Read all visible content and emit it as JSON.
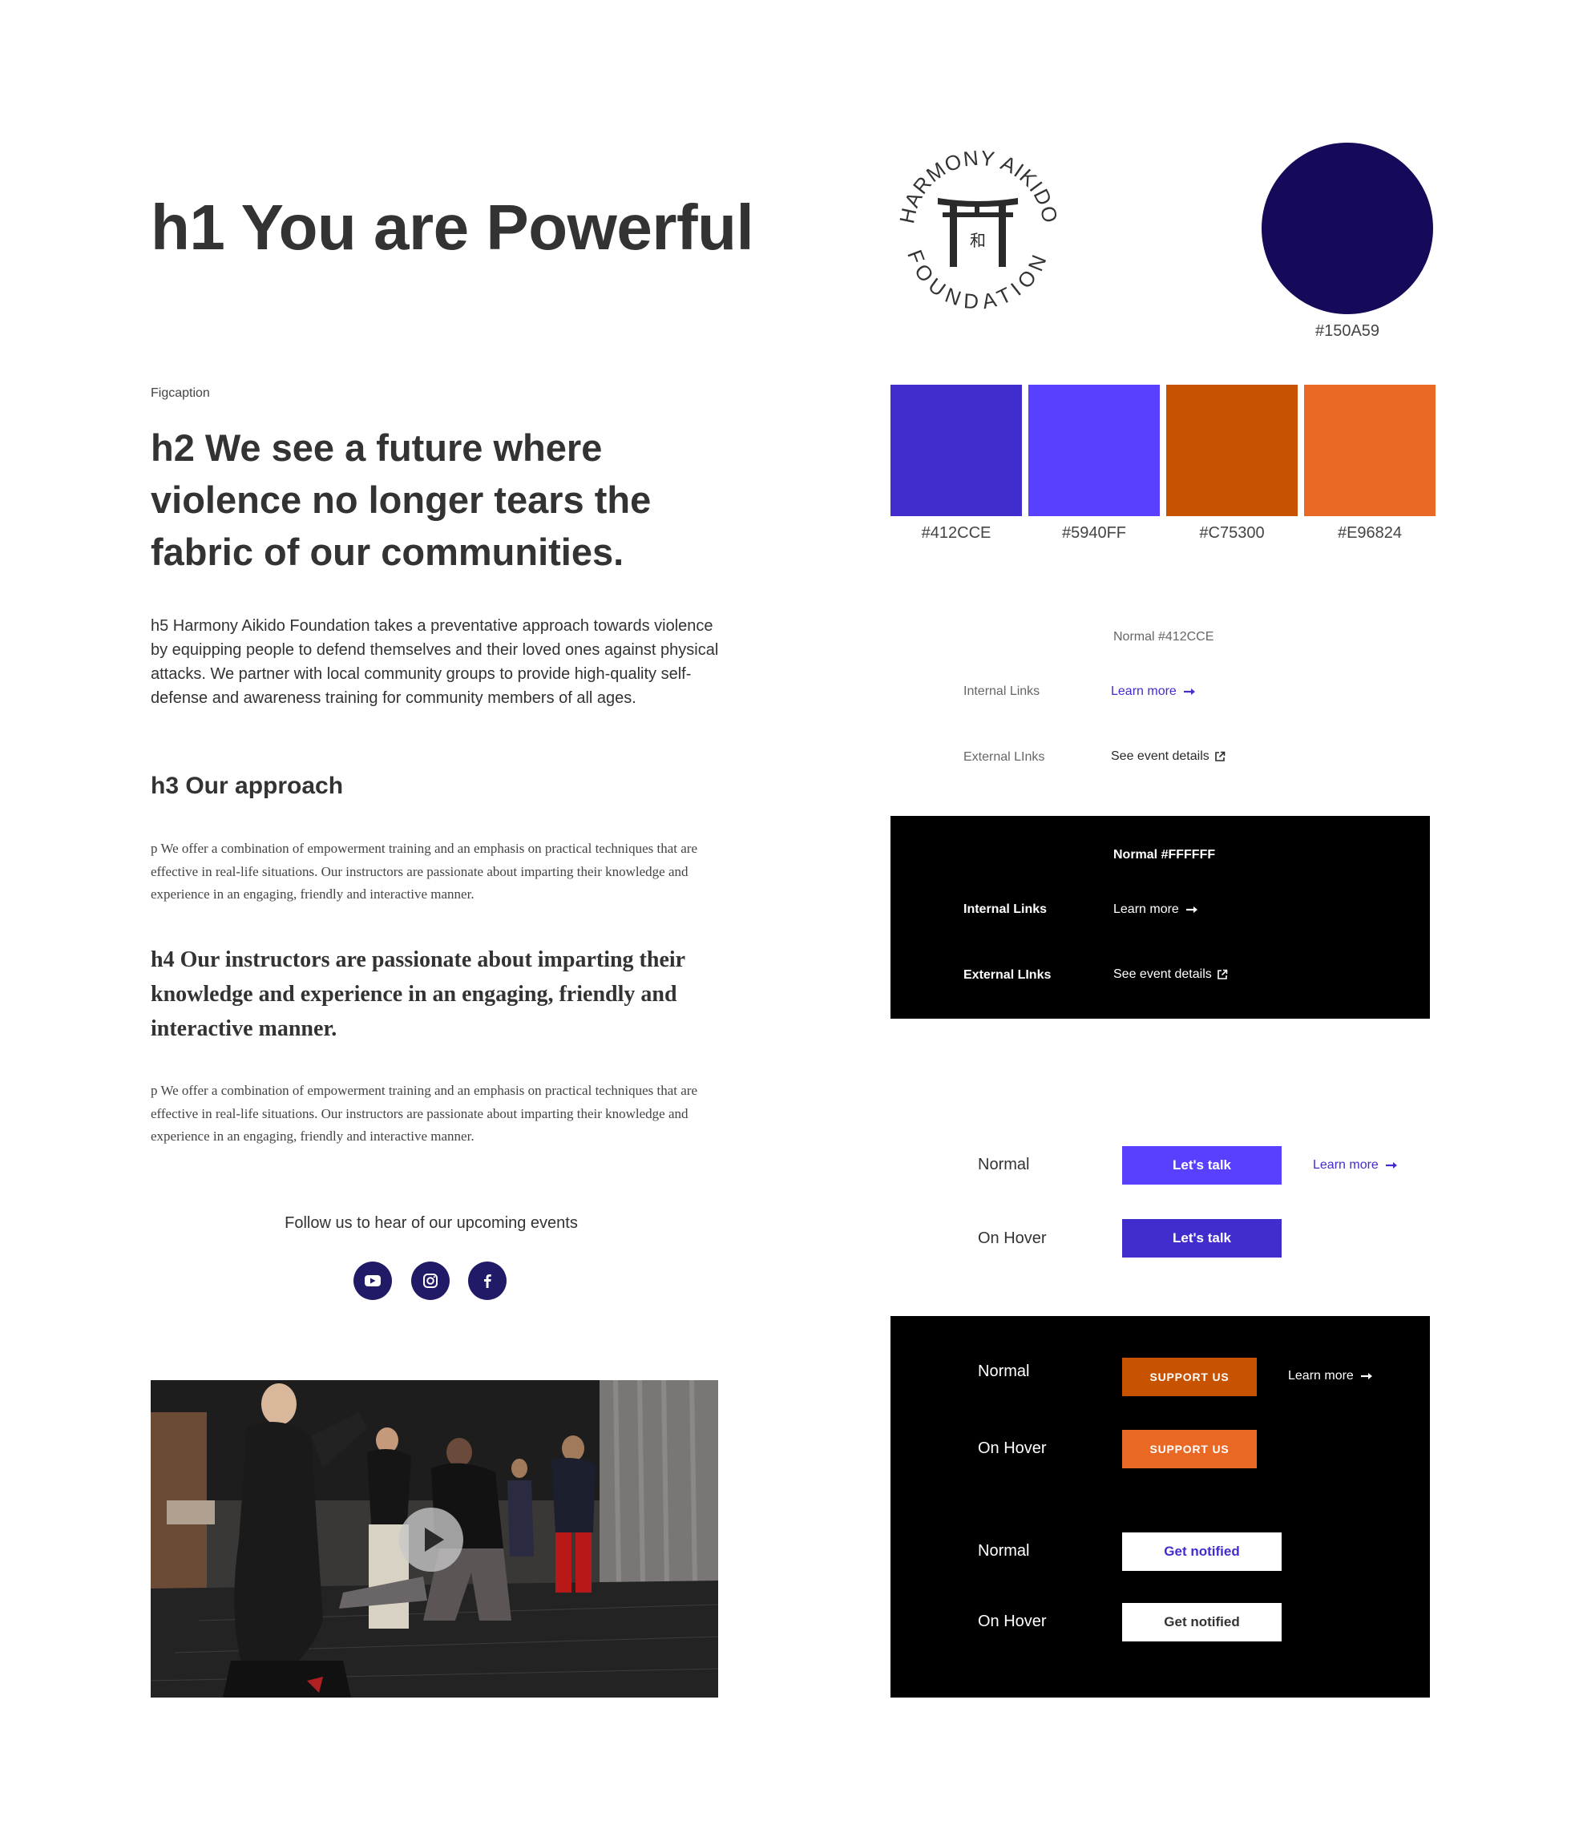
{
  "typography": {
    "h1": "h1 You are Powerful",
    "figcaption": "Figcaption",
    "h2": "h2 We see a future where violence no longer tears the fabric of our communities.",
    "h5": "h5 Harmony Aikido Foundation takes a preventative approach towards violence by equipping people to defend themselves and their loved ones against physical attacks. We partner with local community groups to provide high-quality self-defense and awareness training for community members of all ages.",
    "h3": "h3 Our approach",
    "p1": "p We offer a combination of empowerment training and an emphasis on practical techniques that are effective in real-life situations.  Our instructors are passionate about imparting their knowledge and experience in an engaging, friendly and interactive manner.",
    "h4": "h4 Our instructors are passionate about imparting their knowledge and experience in an engaging, friendly and interactive manner.",
    "p2": "p We offer a combination of empowerment training and an emphasis on practical techniques that are effective in real-life situations.  Our instructors are passionate about imparting their knowledge and experience in an engaging, friendly and interactive manner."
  },
  "social": {
    "text": "Follow us to hear of our upcoming events",
    "icons": [
      "youtube-icon",
      "instagram-icon",
      "facebook-icon"
    ],
    "bg_color": "#211A66"
  },
  "logo": {
    "top_text": "HARMONY AIKIDO",
    "bottom_text": "FOUNDATION"
  },
  "palette": {
    "primary": {
      "hex": "#150A59",
      "label": "#150A59"
    },
    "swatches": [
      {
        "hex": "#412CCE",
        "label": "#412CCE"
      },
      {
        "hex": "#5940FF",
        "label": "#5940FF"
      },
      {
        "hex": "#C75300",
        "label": "#C75300"
      },
      {
        "hex": "#E96824",
        "label": "#E96824"
      }
    ]
  },
  "links_light": {
    "heading": "Normal #412CCE",
    "internal_label": "Internal Links",
    "internal_link": "Learn more",
    "external_label": "External LInks",
    "external_link": "See event details",
    "link_color": "#412CCE"
  },
  "links_dark": {
    "heading": "Normal #FFFFFF",
    "internal_label": "Internal Links",
    "internal_link": "Learn more",
    "external_label": "External LInks",
    "external_link": "See event details"
  },
  "buttons_light": {
    "normal_label": "Normal",
    "hover_label": "On Hover",
    "primary_normal": "Let's talk",
    "primary_hover": "Let's talk",
    "link": "Learn more",
    "normal_color": "#5940FF",
    "hover_color": "#412CCE"
  },
  "buttons_dark": {
    "normal_label": "Normal",
    "hover_label": "On Hover",
    "support_normal": "SUPPORT US",
    "support_hover": "SUPPORT US",
    "link": "Learn more",
    "support_normal_color": "#C75300",
    "support_hover_color": "#E96824",
    "normal2_label": "Normal",
    "hover2_label": "On Hover",
    "notify_normal": "Get notified",
    "notify_hover": "Get notified",
    "notify_normal_text_color": "#412CCE",
    "notify_hover_text_color": "#333333"
  },
  "video": {
    "play_icon": "play-icon"
  }
}
